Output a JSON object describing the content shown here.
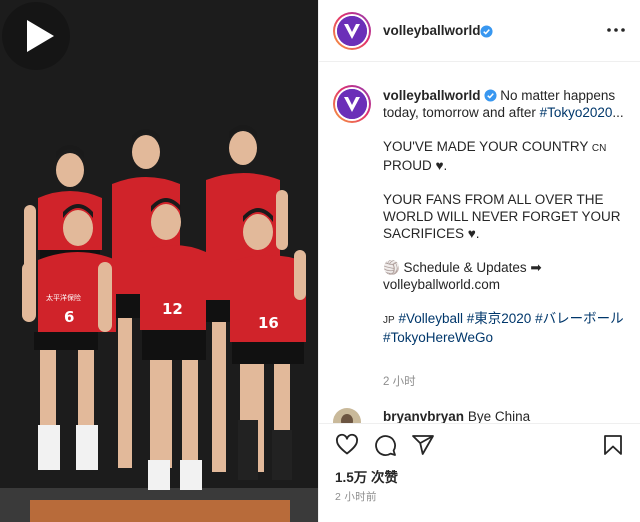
{
  "post": {
    "account": {
      "username": "volleyballworld",
      "verified": true,
      "avatar_color": "#6b2fb8"
    },
    "header": {
      "more_icon": "more-horizontal-icon"
    },
    "media": {
      "play_icon": "play-icon",
      "jersey_color": "#d0232a",
      "player_numbers": [
        "6",
        "12",
        "16"
      ],
      "jersey_text": "太平洋保险"
    },
    "caption": {
      "username": "volleyballworld",
      "line1": "No matter happens today, tomorrow and after",
      "line1_tag": "#Tokyo2020",
      "line1_tail": "...",
      "para2_a": "YOU'VE MADE YOUR COUNTRY",
      "para2_flag": "CN",
      "para2_b": "PROUD",
      "para2_heart": "♥.",
      "para3": "YOUR FANS FROM ALL OVER THE WORLD WILL NEVER FORGET YOUR SACRIFICES",
      "para3_heart": "♥.",
      "para4_a": "🏐 Schedule & Updates ➡",
      "para4_b": "volleyballworld.com",
      "flag_jp": "JP",
      "tags": [
        "#Volleyball",
        "#東京2020",
        "#バレーボール",
        "#TokyoHereWeGo"
      ],
      "time": "2 小时"
    },
    "next_comment": {
      "username": "bryanvbryan",
      "text": "Bye China"
    },
    "actions": {
      "like_icon": "heart-icon",
      "comment_icon": "comment-icon",
      "share_icon": "share-icon",
      "save_icon": "bookmark-icon"
    },
    "likes": "1.5万 次赞",
    "posted": "2 小时前"
  }
}
